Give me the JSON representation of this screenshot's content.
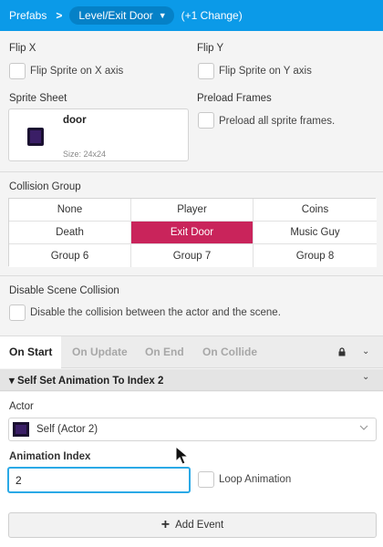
{
  "header": {
    "breadcrumb_root": "Prefabs",
    "breadcrumb_separator": ">",
    "prefab_name": "Level/Exit Door",
    "changes": "(+1 Change)"
  },
  "flip_x": {
    "title": "Flip X",
    "checkbox_label": "Flip Sprite on X axis",
    "checked": false
  },
  "flip_y": {
    "title": "Flip Y",
    "checkbox_label": "Flip Sprite on Y axis",
    "checked": false
  },
  "sprite_sheet": {
    "title": "Sprite Sheet",
    "name": "door",
    "size": "Size:  24x24"
  },
  "preload_frames": {
    "title": "Preload Frames",
    "checkbox_label": "Preload all sprite frames.",
    "checked": false
  },
  "collision_group": {
    "title": "Collision Group",
    "options": [
      "None",
      "Player",
      "Coins",
      "Death",
      "Exit Door",
      "Music Guy",
      "Group 6",
      "Group 7",
      "Group 8"
    ],
    "selected": "Exit Door"
  },
  "disable_collision": {
    "title": "Disable Scene Collision",
    "checkbox_label": "Disable the collision between the actor and the scene.",
    "checked": false
  },
  "tabs": [
    "On Start",
    "On Update",
    "On End",
    "On Collide"
  ],
  "active_tab": "On Start",
  "event": {
    "title": "Self Set Animation To Index 2",
    "actor_label": "Actor",
    "actor_value": "Self (Actor 2)",
    "animation_index_label": "Animation Index",
    "animation_index_value": "2",
    "loop_label": "Loop Animation"
  },
  "add_event_label": "Add Event",
  "colors": {
    "header": "#0b9ae8",
    "selected_group": "#c9245b",
    "input_focus": "#2aa9e6"
  }
}
